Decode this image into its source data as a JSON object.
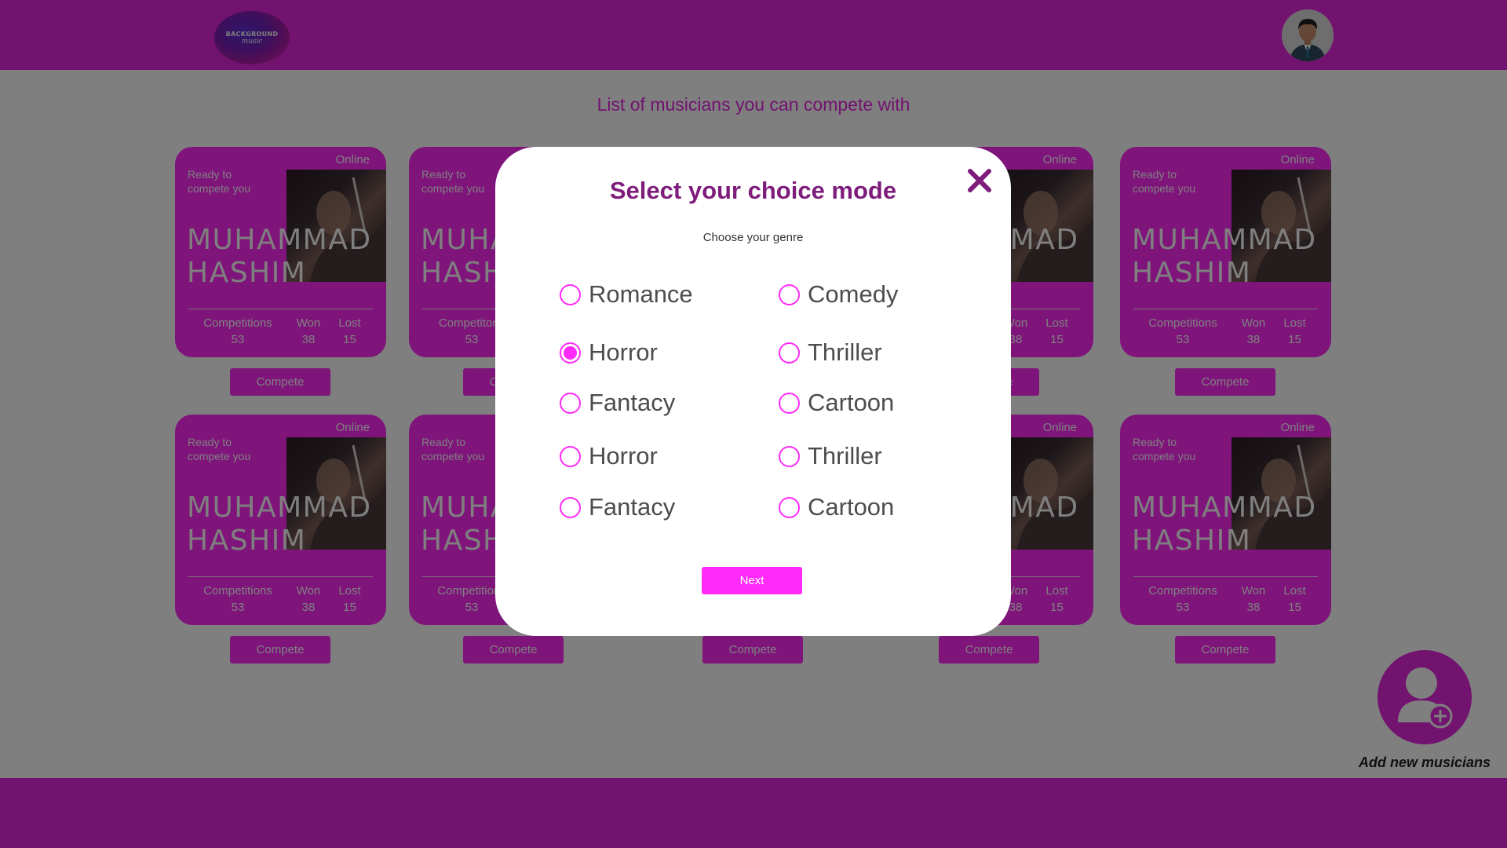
{
  "header": {
    "logo_line1": "BACKGROUND",
    "logo_line2": "music"
  },
  "page": {
    "title": "List of musicians you can compete with"
  },
  "card": {
    "status": "Online",
    "ready_text": "Ready to compete you",
    "name_line1": "MUHAMMAD",
    "name_line2": "HASHIM",
    "competitions_label": "Competitions",
    "competitions_label_alt": "Competitons",
    "won_label": "Won",
    "lost_label": "Lost",
    "competitions": "53",
    "won": "38",
    "lost": "15",
    "button_label": "Compete"
  },
  "add_musician": {
    "label": "Add new musicians"
  },
  "modal": {
    "title": "Select your choice mode",
    "subtitle": "Choose your genre",
    "options": [
      {
        "label": "Romance",
        "checked": false
      },
      {
        "label": "Comedy",
        "checked": false
      },
      {
        "label": "Horror",
        "checked": true
      },
      {
        "label": "Thriller",
        "checked": false
      },
      {
        "label": "Fantacy",
        "checked": false
      },
      {
        "label": "Cartoon",
        "checked": false
      },
      {
        "label": "Horror",
        "checked": false
      },
      {
        "label": "Thriller",
        "checked": false
      },
      {
        "label": "Fantacy",
        "checked": false
      },
      {
        "label": "Cartoon",
        "checked": false
      }
    ],
    "next_label": "Next"
  },
  "colors": {
    "brand": "#e526e0",
    "accent": "#ff2af7",
    "title": "#7e1c7b"
  },
  "icons": {
    "close": "close-icon",
    "add_user": "add-user-icon",
    "avatar": "avatar-icon"
  }
}
